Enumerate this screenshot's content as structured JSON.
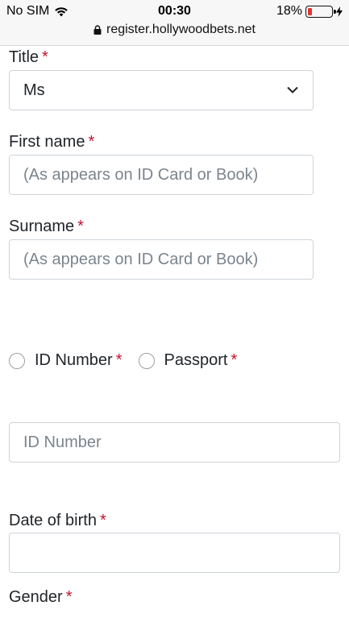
{
  "status": {
    "carrier": "No SIM",
    "time": "00:30",
    "battery": "18%",
    "battery_level": 0.18,
    "url": "register.hollywoodbets.net"
  },
  "form": {
    "title_label": "Title",
    "title_value": "Ms",
    "first_name_label": "First name",
    "first_name_placeholder": "(As appears on ID Card or Book)",
    "surname_label": "Surname",
    "surname_placeholder": "(As appears on ID Card or Book)",
    "id_number_option": "ID Number",
    "passport_option": "Passport",
    "id_number_placeholder": "ID Number",
    "dob_label": "Date of birth",
    "gender_label": "Gender",
    "required_mark": "*"
  }
}
